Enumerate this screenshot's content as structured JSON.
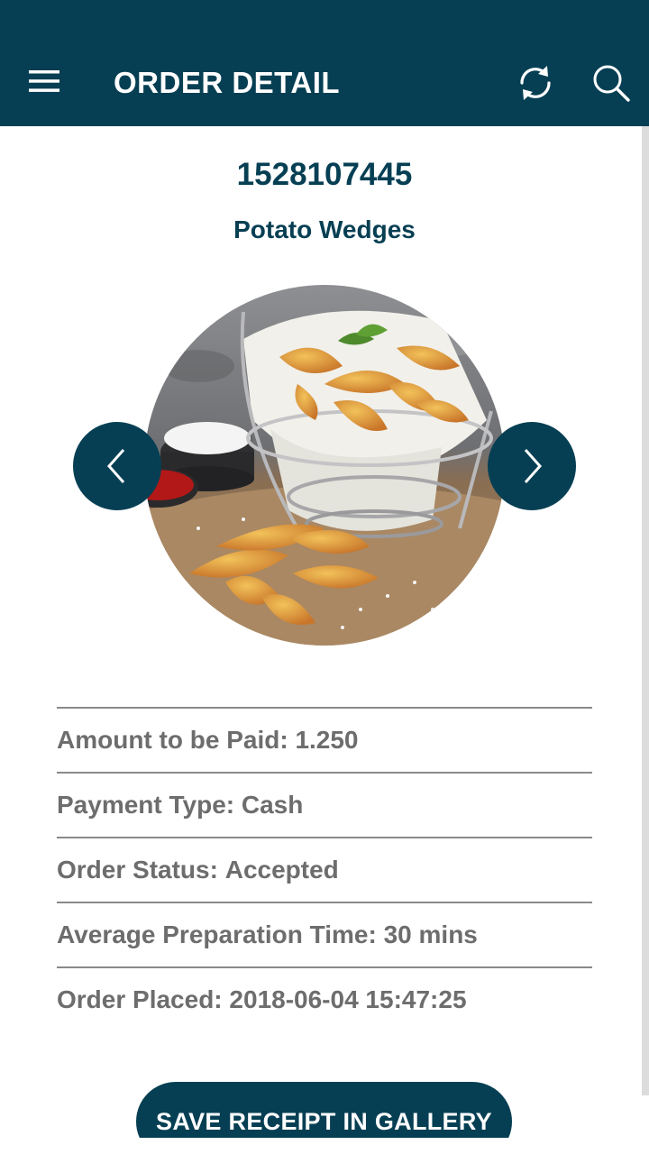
{
  "header": {
    "title": "ORDER DETAIL",
    "menu_icon": "hamburger-menu-icon",
    "refresh_icon": "refresh-icon",
    "search_icon": "search-icon"
  },
  "order": {
    "number": "1528107445",
    "product_name": "Potato Wedges",
    "product_image": "potato-wedges-photo"
  },
  "carousel": {
    "prev_icon": "chevron-left-icon",
    "next_icon": "chevron-right-icon"
  },
  "details": [
    {
      "label": "Amount to be Paid:",
      "value": "1.250"
    },
    {
      "label": "Payment Type:",
      "value": "Cash"
    },
    {
      "label": "Order Status:",
      "value": "Accepted"
    },
    {
      "label": "Average Preparation Time:",
      "value": "30 mins"
    },
    {
      "label": "Order Placed:",
      "value": "2018-06-04 15:47:25"
    }
  ],
  "actions": {
    "save_receipt_label": "SAVE RECEIPT IN GALLERY"
  },
  "colors": {
    "primary": "#063f53",
    "text_muted": "#6d6d6d",
    "divider": "#8a8a8a",
    "background": "#ffffff"
  }
}
